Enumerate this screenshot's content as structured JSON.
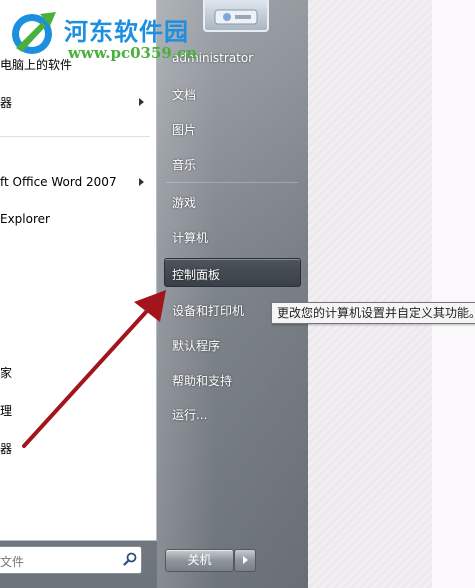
{
  "watermark": {
    "title": "河东软件园",
    "url": "www.pc0359.cn"
  },
  "left_programs": [
    {
      "label": "电脑上的软件"
    },
    {
      "label": "器"
    },
    {
      "label": "ft Office Word 2007"
    },
    {
      "label": "Explorer"
    },
    {
      "label": "家"
    },
    {
      "label": "理"
    },
    {
      "label": "器"
    }
  ],
  "search": {
    "text": "文件"
  },
  "right_items": {
    "user": "administrator",
    "documents": "文档",
    "pictures": "图片",
    "music": "音乐",
    "games": "游戏",
    "computer": "计算机",
    "control_panel": "控制面板",
    "devices": "设备和打印机",
    "default_programs": "默认程序",
    "help": "帮助和支持",
    "run": "运行..."
  },
  "tooltip": "更改您的计算机设置并自定义其功能。",
  "shutdown": {
    "label": "关机"
  },
  "colors": {
    "annotation_arrow": "#a3151c",
    "watermark_blue": "#1d8fe0",
    "watermark_green": "#49b03b"
  }
}
